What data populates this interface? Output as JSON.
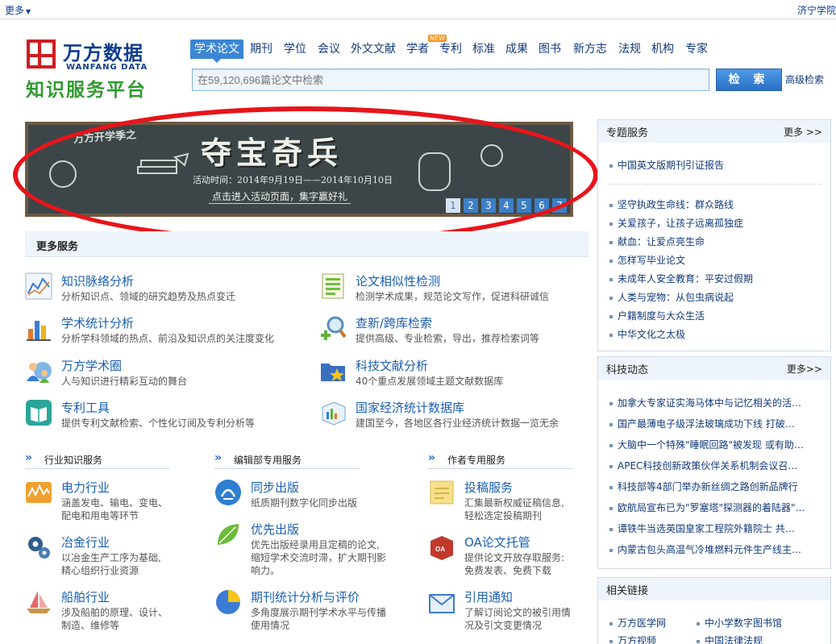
{
  "topbar": {
    "more_label": "更多",
    "institution": "济宁学院"
  },
  "logo": {
    "cn": "万方数据",
    "en": "WANFANG DATA",
    "sub": "知识服务平台"
  },
  "nav": {
    "tabs": [
      "学术论文",
      "期刊",
      "学位",
      "会议",
      "外文文献",
      "学者",
      "专利",
      "标准",
      "成果",
      "图书",
      "新方志",
      "法规",
      "机构",
      "专家"
    ],
    "new_badge": "NEW"
  },
  "search": {
    "placeholder": "在59,120,696篇论文中检索",
    "button": "检 索",
    "advanced": "高级检索"
  },
  "banner": {
    "tag": "万方开学季之",
    "title": "夺宝奇兵",
    "date": "活动时间：2014年9月19日——2014年10月10日",
    "cta": "点击进入活动页面，集字赢好礼",
    "slides": [
      "1",
      "2",
      "3",
      "4",
      "5",
      "6",
      "7"
    ]
  },
  "more_services": {
    "title": "更多服务",
    "items": [
      {
        "title": "知识脉络分析",
        "desc": "分析知识点、领域的研究趋势及热点变迁"
      },
      {
        "title": "论文相似性检测",
        "desc": "检测学术成果，规范论文写作，促进科研诚信"
      },
      {
        "title": "学术统计分析",
        "desc": "分析学科领域的热点、前沿及知识点的关注度变化"
      },
      {
        "title": "查新/跨库检索",
        "desc": "提供高级、专业检索，导出，推荐检索词等"
      },
      {
        "title": "万方学术圈",
        "desc": "人与知识进行精彩互动的舞台"
      },
      {
        "title": "科技文献分析",
        "desc": "40个重点发展领域主题文献数据库"
      },
      {
        "title": "专利工具",
        "desc": "提供专利文献检索、个性化订阅及专利分析等"
      },
      {
        "title": "国家经济统计数据库",
        "desc": "建国至今，各地区各行业经济统计数据一览无余"
      }
    ]
  },
  "sections": {
    "industry": {
      "title": "行业知识服务",
      "items": [
        {
          "title": "电力行业",
          "desc": [
            "涵盖发电、输电、变电、",
            "配电和用电等环节"
          ]
        },
        {
          "title": "冶金行业",
          "desc": [
            "以冶金生产工序为基础,",
            "精心组织行业资源"
          ]
        },
        {
          "title": "船舶行业",
          "desc": [
            "涉及船舶的原理、设计、",
            "制造、维修等"
          ]
        }
      ]
    },
    "editorial": {
      "title": "编辑部专用服务",
      "items": [
        {
          "title": "同步出版",
          "desc": [
            "纸质期刊数字化同步出版"
          ]
        },
        {
          "title": "优先出版",
          "desc": [
            "优先出版经录用且定稿的论文,",
            "缩短学术交流时滞，扩大期刊影",
            "响力。"
          ]
        },
        {
          "title": "期刊统计分析与评价",
          "desc": [
            "多角度展示期刊学术水平与传播",
            "使用情况"
          ]
        }
      ]
    },
    "author": {
      "title": "作者专用服务",
      "items": [
        {
          "title": "投稿服务",
          "desc": [
            "汇集最新权威征稿信息,",
            "轻松选定投稿期刊"
          ]
        },
        {
          "title": "OA论文托管",
          "desc": [
            "提供论文开放存取服务:",
            "免费发表、免费下载"
          ]
        },
        {
          "title": "引用通知",
          "desc": [
            "了解订阅论文的被引用情",
            "况及引文变更情况"
          ]
        }
      ]
    }
  },
  "sidebar": {
    "special": {
      "title": "专题服务",
      "more": "更多 >>",
      "top_item": "中国英文版期刊引证报告",
      "items": [
        "坚守执政生命线：群众路线",
        "关爱孩子，让孩子远离孤独症",
        "献血：让爱点亮生命",
        "怎样写毕业论文",
        "未成年人安全教育：平安过假期",
        "人类与宠物：从包虫病说起",
        "户籍制度与大众生活",
        "中华文化之太极"
      ]
    },
    "tech": {
      "title": "科技动态",
      "more": "更多>>",
      "items": [
        "加拿大专家证实海马体中与记忆相关的活…",
        "国产最薄电子级浮法玻璃成功下线 打破…",
        "大脑中一个特殊\"睡眠回路\"被发现 或有助…",
        "APEC科技创新政策伙伴关系机制会议召…",
        "科技部等4部门举办新丝绸之路创新品牌行",
        "欧航局宣布已为\"罗塞塔\"探测器的着陆器\"…",
        "谭铁牛当选英国皇家工程院外籍院士 共…",
        "内蒙古包头高温气冷堆燃料元件生产线主…"
      ]
    },
    "links": {
      "title": "相关链接",
      "items": [
        "万方医学网",
        "中小学数字图书馆",
        "万方视频",
        "中国法律法规"
      ]
    }
  },
  "colors": {
    "brand_blue": "#0d3d8e",
    "brand_red": "#d01c21",
    "brand_green": "#2f9a2f",
    "link_blue": "#1b5fb0",
    "annotation_red": "#e8141a"
  },
  "icons": [
    "chevron-down-icon",
    "trend-chart-icon",
    "document-list-icon",
    "bar-chart-icon",
    "magnifier-plus-icon",
    "people-globe-icon",
    "folder-star-icon",
    "book-icon",
    "cube-chart-icon",
    "power-chart-icon",
    "gears-icon",
    "ship-icon",
    "sync-circle-icon",
    "green-leaf-icon",
    "pie-chart-icon",
    "notepad-icon",
    "oa-box-icon",
    "envelope-icon"
  ]
}
